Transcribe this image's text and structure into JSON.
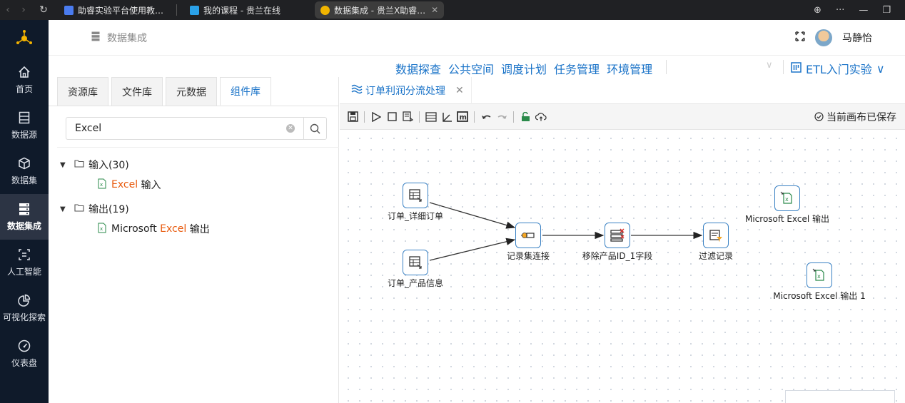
{
  "browser": {
    "tabs": [
      {
        "title": "助睿实验平台使用教…",
        "icon_color": "#4a7cf0"
      },
      {
        "title": "我的课程 - 贵兰在线",
        "icon_color": "#2aa1e8"
      },
      {
        "title": "数据集成 - 贵兰X助睿…",
        "icon_color": "#f0b400"
      }
    ]
  },
  "sidebar": {
    "items": [
      {
        "label": "首页",
        "icon": "home-icon"
      },
      {
        "label": "数据源",
        "icon": "datasource-icon"
      },
      {
        "label": "数据集",
        "icon": "dataset-icon"
      },
      {
        "label": "数据集成",
        "icon": "integration-icon",
        "active": true
      },
      {
        "label": "人工智能",
        "icon": "ai-icon"
      },
      {
        "label": "可视化探索",
        "icon": "chart-icon"
      },
      {
        "label": "仪表盘",
        "icon": "dashboard-icon"
      }
    ]
  },
  "header": {
    "breadcrumb": "数据集成",
    "user_name": "马静怡"
  },
  "menu": {
    "items": [
      "数据探查",
      "公共空间",
      "调度计划",
      "任务管理",
      "环境管理"
    ],
    "project": "ETL入门实验"
  },
  "left_panel": {
    "tabs": [
      "资源库",
      "文件库",
      "元数据",
      "组件库"
    ],
    "active_tab": "组件库",
    "search_value": "Excel",
    "tree": [
      {
        "label": "输入(30)",
        "leaf_prefix": "",
        "leaf_highlight": "Excel",
        "leaf_suffix": " 输入"
      },
      {
        "label": "输出(19)",
        "leaf_prefix": "Microsoft ",
        "leaf_highlight": "Excel",
        "leaf_suffix": " 输出"
      }
    ]
  },
  "workspace": {
    "tab_title": "订单利润分流处理",
    "saved_status": "当前画布已保存",
    "nodes": [
      {
        "label": "订单_详细订单"
      },
      {
        "label": "订单_产品信息"
      },
      {
        "label": "记录集连接"
      },
      {
        "label": "移除产品ID_1字段"
      },
      {
        "label": "过滤记录"
      },
      {
        "label": "Microsoft Excel 输出"
      },
      {
        "label": "Microsoft Excel 输出 1"
      }
    ]
  },
  "colors": {
    "accent": "#1a73c8",
    "sidebar_bg": "#0f1a2a",
    "highlight": "#e8590c",
    "node_border": "#3b82c4"
  }
}
